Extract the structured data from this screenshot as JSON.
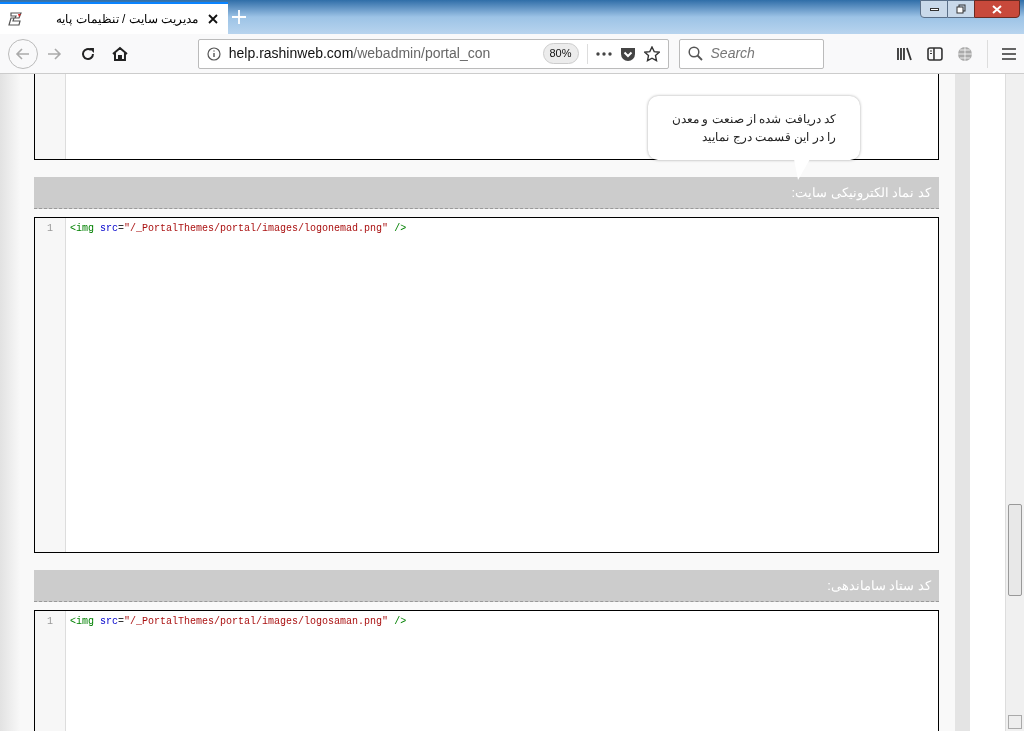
{
  "tab": {
    "title": "مدیریت سایت / تنظیمات پایه"
  },
  "address_bar": {
    "url_host": "help.rashinweb.com",
    "url_path": "/webadmin/portal_con",
    "zoom": "80%"
  },
  "search": {
    "placeholder": "Search"
  },
  "tooltip": {
    "text": "کد دریافت شده از صنعت و معدن\nرا در این قسمت درج نمایید"
  },
  "sections": [
    {
      "kind": "editor"
    },
    {
      "kind": "header",
      "label": "کد نماد الکترونیکی سایت:"
    },
    {
      "kind": "editor",
      "lines": [
        {
          "number": "1",
          "code": {
            "tag_open": "<img",
            "attribute": "src",
            "equals": "=",
            "value": "\"/_PortalThemes/portal/images/logonemad.png\"",
            "tag_close": "/>"
          }
        }
      ]
    },
    {
      "kind": "header",
      "label": "کد ستاد ساماندهی:"
    },
    {
      "kind": "editor",
      "lines": [
        {
          "number": "1",
          "code": {
            "tag_open": "<img",
            "attribute": "src",
            "equals": "=",
            "value": "\"/_PortalThemes/portal/images/logosaman.png\"",
            "tag_close": "/>"
          }
        }
      ]
    }
  ]
}
